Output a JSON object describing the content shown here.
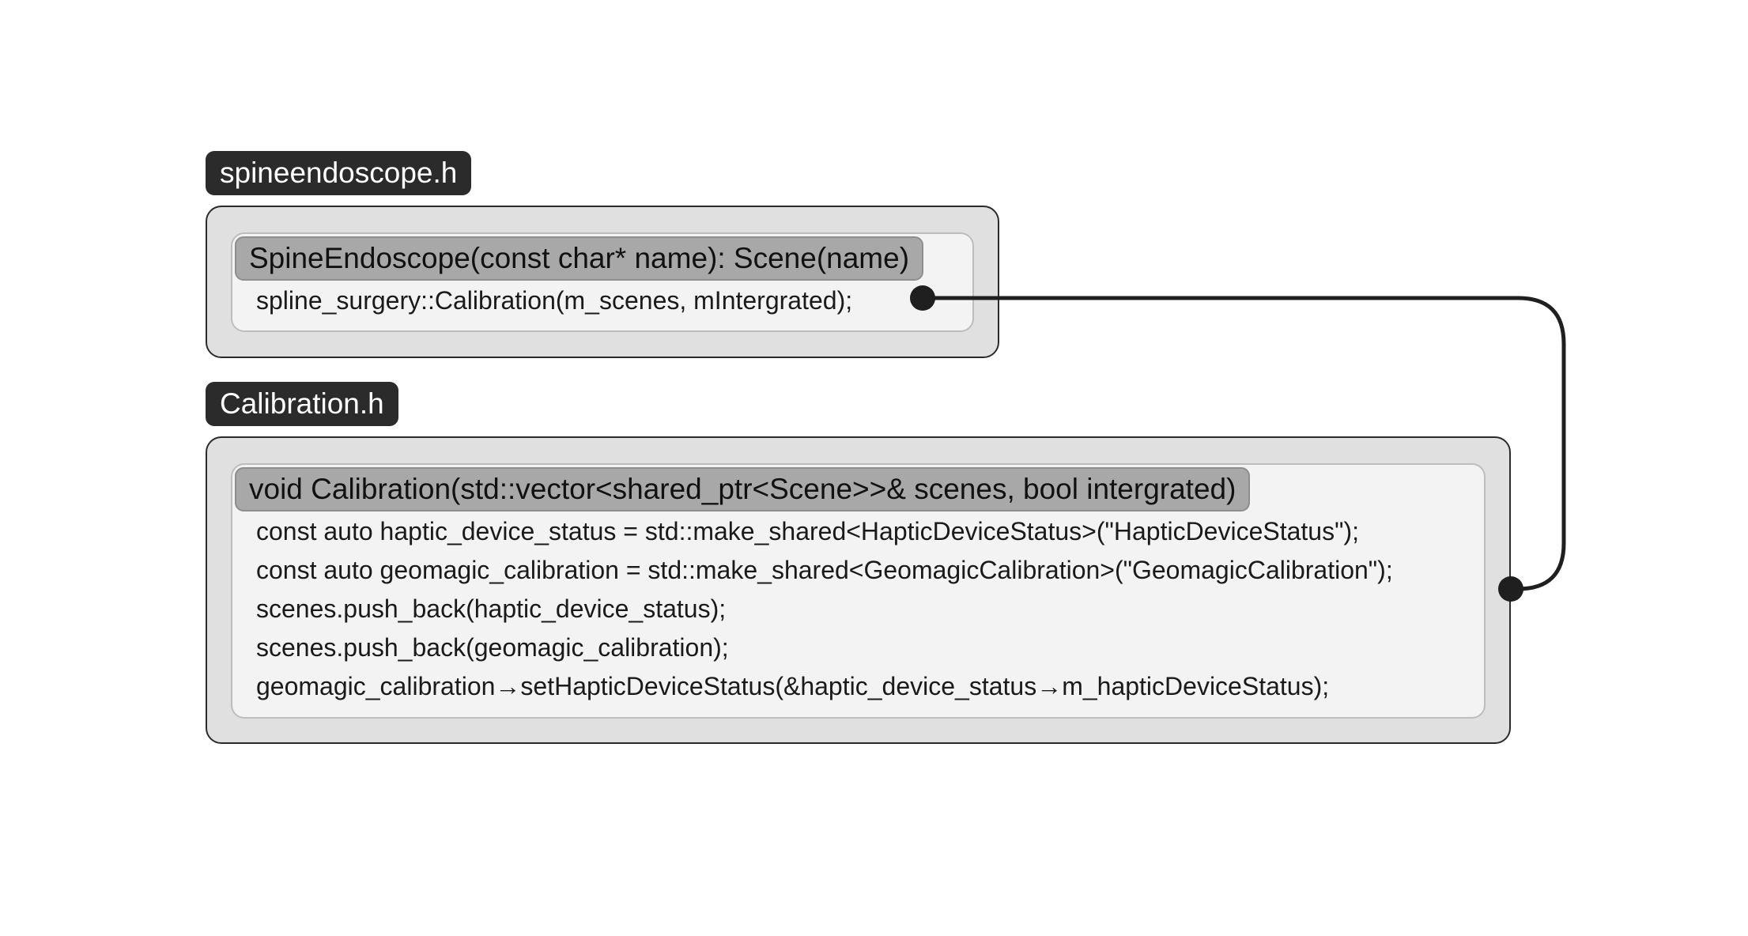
{
  "files": [
    {
      "name": "spineendoscope.h",
      "function": {
        "signature": "SpineEndoscope(const char* name): Scene(name)",
        "lines": [
          "spline_surgery::Calibration(m_scenes, mIntergrated);"
        ]
      }
    },
    {
      "name": "Calibration.h",
      "function": {
        "signature": "void Calibration(std::vector<shared_ptr<Scene>>& scenes, bool intergrated)",
        "lines": [
          "const auto haptic_device_status = std::make_shared<HapticDeviceStatus>(\"HapticDeviceStatus\");",
          "const auto geomagic_calibration = std::make_shared<GeomagicCalibration>(\"GeomagicCalibration\");",
          "scenes.push_back(haptic_device_status);",
          "scenes.push_back(geomagic_calibration);",
          "geomagic_calibration→setHapticDeviceStatus(&haptic_device_status→m_hapticDeviceStatus);"
        ]
      }
    }
  ],
  "connector": {
    "from": "spline_surgery::Calibration(m_scenes, mIntergrated);",
    "to": "Calibration.h",
    "color": "#1f1f1f"
  }
}
